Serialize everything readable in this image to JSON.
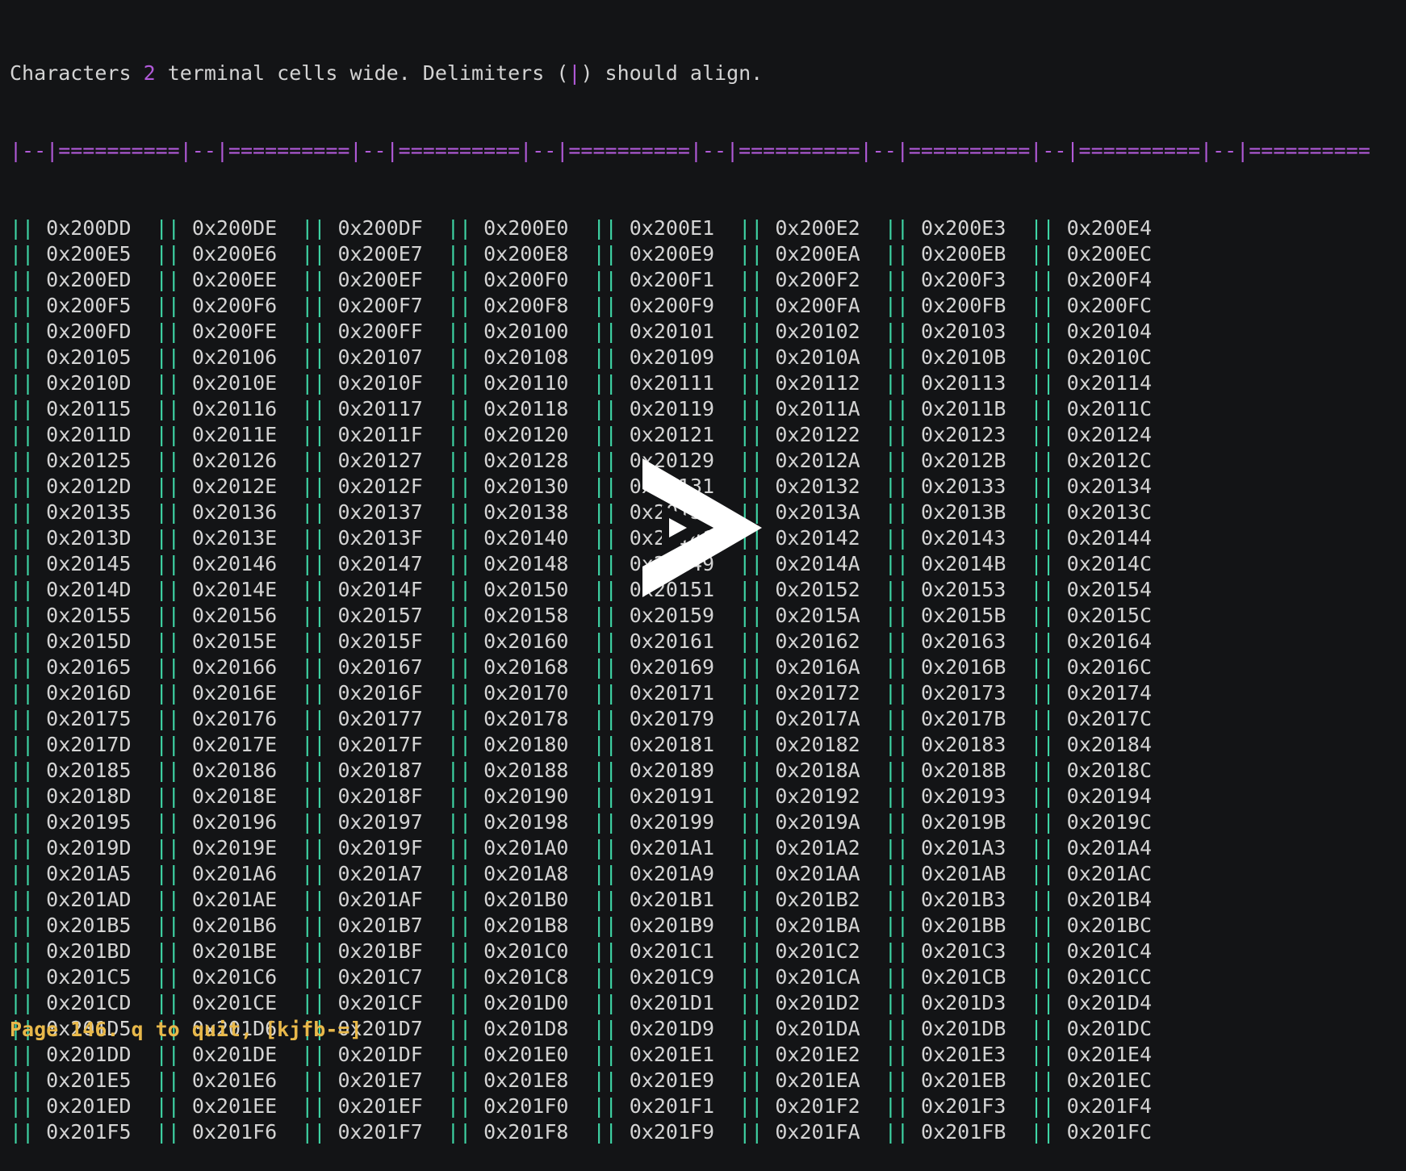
{
  "header": {
    "prefix": "Characters ",
    "width_value": "2",
    "middle": " terminal cells wide. Delimiters (",
    "delim_char": "|",
    "suffix": ") should align."
  },
  "ruler": "|--|==========|--|==========|--|==========|--|==========|--|==========|--|==========|--|==========|--|==========",
  "delimiter": "||",
  "rows": [
    [
      "0x200DD",
      "0x200DE",
      "0x200DF",
      "0x200E0",
      "0x200E1",
      "0x200E2",
      "0x200E3",
      "0x200E4"
    ],
    [
      "0x200E5",
      "0x200E6",
      "0x200E7",
      "0x200E8",
      "0x200E9",
      "0x200EA",
      "0x200EB",
      "0x200EC"
    ],
    [
      "0x200ED",
      "0x200EE",
      "0x200EF",
      "0x200F0",
      "0x200F1",
      "0x200F2",
      "0x200F3",
      "0x200F4"
    ],
    [
      "0x200F5",
      "0x200F6",
      "0x200F7",
      "0x200F8",
      "0x200F9",
      "0x200FA",
      "0x200FB",
      "0x200FC"
    ],
    [
      "0x200FD",
      "0x200FE",
      "0x200FF",
      "0x20100",
      "0x20101",
      "0x20102",
      "0x20103",
      "0x20104"
    ],
    [
      "0x20105",
      "0x20106",
      "0x20107",
      "0x20108",
      "0x20109",
      "0x2010A",
      "0x2010B",
      "0x2010C"
    ],
    [
      "0x2010D",
      "0x2010E",
      "0x2010F",
      "0x20110",
      "0x20111",
      "0x20112",
      "0x20113",
      "0x20114"
    ],
    [
      "0x20115",
      "0x20116",
      "0x20117",
      "0x20118",
      "0x20119",
      "0x2011A",
      "0x2011B",
      "0x2011C"
    ],
    [
      "0x2011D",
      "0x2011E",
      "0x2011F",
      "0x20120",
      "0x20121",
      "0x20122",
      "0x20123",
      "0x20124"
    ],
    [
      "0x20125",
      "0x20126",
      "0x20127",
      "0x20128",
      "0x20129",
      "0x2012A",
      "0x2012B",
      "0x2012C"
    ],
    [
      "0x2012D",
      "0x2012E",
      "0x2012F",
      "0x20130",
      "0x20131",
      "0x20132",
      "0x20133",
      "0x20134"
    ],
    [
      "0x20135",
      "0x20136",
      "0x20137",
      "0x20138",
      "0x20139",
      "0x2013A",
      "0x2013B",
      "0x2013C"
    ],
    [
      "0x2013D",
      "0x2013E",
      "0x2013F",
      "0x20140",
      "0x20141",
      "0x20142",
      "0x20143",
      "0x20144"
    ],
    [
      "0x20145",
      "0x20146",
      "0x20147",
      "0x20148",
      "0x20149",
      "0x2014A",
      "0x2014B",
      "0x2014C"
    ],
    [
      "0x2014D",
      "0x2014E",
      "0x2014F",
      "0x20150",
      "0x20151",
      "0x20152",
      "0x20153",
      "0x20154"
    ],
    [
      "0x20155",
      "0x20156",
      "0x20157",
      "0x20158",
      "0x20159",
      "0x2015A",
      "0x2015B",
      "0x2015C"
    ],
    [
      "0x2015D",
      "0x2015E",
      "0x2015F",
      "0x20160",
      "0x20161",
      "0x20162",
      "0x20163",
      "0x20164"
    ],
    [
      "0x20165",
      "0x20166",
      "0x20167",
      "0x20168",
      "0x20169",
      "0x2016A",
      "0x2016B",
      "0x2016C"
    ],
    [
      "0x2016D",
      "0x2016E",
      "0x2016F",
      "0x20170",
      "0x20171",
      "0x20172",
      "0x20173",
      "0x20174"
    ],
    [
      "0x20175",
      "0x20176",
      "0x20177",
      "0x20178",
      "0x20179",
      "0x2017A",
      "0x2017B",
      "0x2017C"
    ],
    [
      "0x2017D",
      "0x2017E",
      "0x2017F",
      "0x20180",
      "0x20181",
      "0x20182",
      "0x20183",
      "0x20184"
    ],
    [
      "0x20185",
      "0x20186",
      "0x20187",
      "0x20188",
      "0x20189",
      "0x2018A",
      "0x2018B",
      "0x2018C"
    ],
    [
      "0x2018D",
      "0x2018E",
      "0x2018F",
      "0x20190",
      "0x20191",
      "0x20192",
      "0x20193",
      "0x20194"
    ],
    [
      "0x20195",
      "0x20196",
      "0x20197",
      "0x20198",
      "0x20199",
      "0x2019A",
      "0x2019B",
      "0x2019C"
    ],
    [
      "0x2019D",
      "0x2019E",
      "0x2019F",
      "0x201A0",
      "0x201A1",
      "0x201A2",
      "0x201A3",
      "0x201A4"
    ],
    [
      "0x201A5",
      "0x201A6",
      "0x201A7",
      "0x201A8",
      "0x201A9",
      "0x201AA",
      "0x201AB",
      "0x201AC"
    ],
    [
      "0x201AD",
      "0x201AE",
      "0x201AF",
      "0x201B0",
      "0x201B1",
      "0x201B2",
      "0x201B3",
      "0x201B4"
    ],
    [
      "0x201B5",
      "0x201B6",
      "0x201B7",
      "0x201B8",
      "0x201B9",
      "0x201BA",
      "0x201BB",
      "0x201BC"
    ],
    [
      "0x201BD",
      "0x201BE",
      "0x201BF",
      "0x201C0",
      "0x201C1",
      "0x201C2",
      "0x201C3",
      "0x201C4"
    ],
    [
      "0x201C5",
      "0x201C6",
      "0x201C7",
      "0x201C8",
      "0x201C9",
      "0x201CA",
      "0x201CB",
      "0x201CC"
    ],
    [
      "0x201CD",
      "0x201CE",
      "0x201CF",
      "0x201D0",
      "0x201D1",
      "0x201D2",
      "0x201D3",
      "0x201D4"
    ],
    [
      "0x201D5",
      "0x201D6",
      "0x201D7",
      "0x201D8",
      "0x201D9",
      "0x201DA",
      "0x201DB",
      "0x201DC"
    ],
    [
      "0x201DD",
      "0x201DE",
      "0x201DF",
      "0x201E0",
      "0x201E1",
      "0x201E2",
      "0x201E3",
      "0x201E4"
    ],
    [
      "0x201E5",
      "0x201E6",
      "0x201E7",
      "0x201E8",
      "0x201E9",
      "0x201EA",
      "0x201EB",
      "0x201EC"
    ],
    [
      "0x201ED",
      "0x201EE",
      "0x201EF",
      "0x201F0",
      "0x201F1",
      "0x201F2",
      "0x201F3",
      "0x201F4"
    ],
    [
      "0x201F5",
      "0x201F6",
      "0x201F7",
      "0x201F8",
      "0x201F9",
      "0x201FA",
      "0x201FB",
      "0x201FC"
    ]
  ],
  "status": "Page 146. q to quit, [kjfb-=]",
  "overlay": {
    "icon": "play-icon"
  },
  "colors": {
    "background": "#131416",
    "text": "#d4d4d4",
    "purple": "#b15ad8",
    "teal": "#3fd6a6",
    "status": "#e8b84a"
  }
}
